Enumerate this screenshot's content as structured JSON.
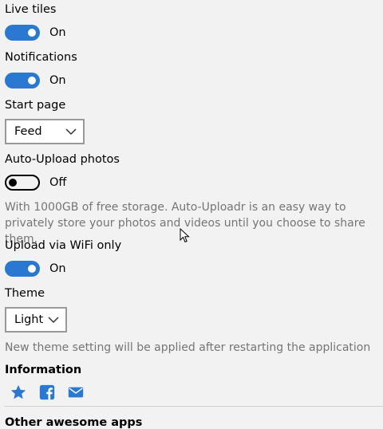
{
  "settings": {
    "live_tiles": {
      "label": "Live tiles",
      "state": "On"
    },
    "notifications": {
      "label": "Notifications",
      "state": "On"
    },
    "start_page": {
      "label": "Start page",
      "value": "Feed"
    },
    "auto_upload": {
      "label": "Auto-Upload photos",
      "state": "Off",
      "description": "With 1000GB of free storage. Auto-Uploadr is an easy way to privately store your photos and videos until you choose to share them."
    },
    "upload_wifi": {
      "label": "Upload via WiFi only",
      "state": "On"
    },
    "theme": {
      "label": "Theme",
      "value": "Light",
      "note": "New theme setting will be applied after restarting the application"
    }
  },
  "information": {
    "heading": "Information",
    "icons": [
      "star-icon",
      "facebook-icon",
      "mail-icon"
    ]
  },
  "other_apps": {
    "heading": "Other awesome apps"
  },
  "colors": {
    "accent": "#2b78d0",
    "text": "#000000",
    "muted": "#757575",
    "background": "#f2f2f2"
  }
}
